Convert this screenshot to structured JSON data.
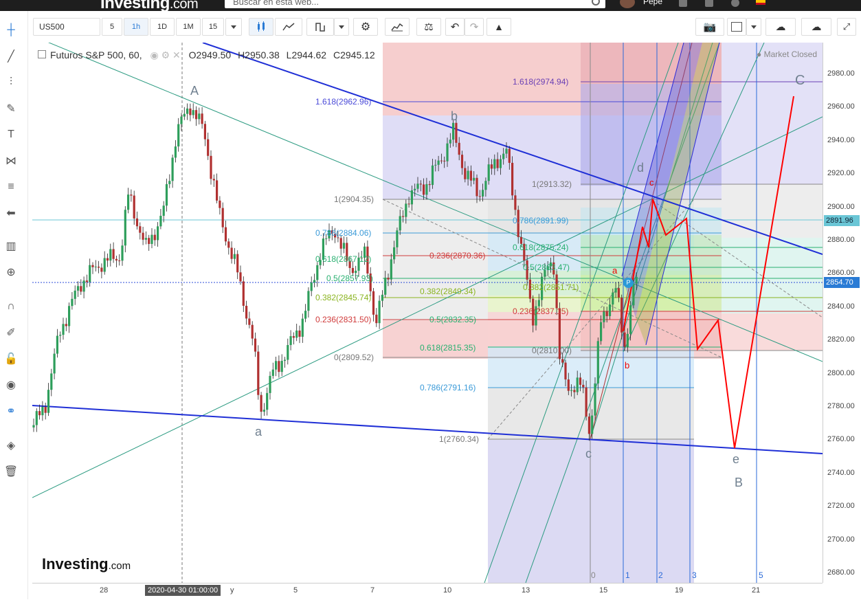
{
  "topbar": {
    "logo_main": "Investing",
    "logo_suffix": ".com",
    "search_placeholder": "Buscar en esta web...",
    "username": "Pepe"
  },
  "toolbar": {
    "symbol": "US500",
    "intervals": [
      "5",
      "1h",
      "1D",
      "1M"
    ],
    "active_interval": "1h",
    "custom_interval": "15"
  },
  "legend": {
    "title": "Futuros S&P 500, 60,",
    "open": "O2949.50",
    "high": "H2950.38",
    "low": "L2944.62",
    "close": "C2945.12"
  },
  "market_status": "Market Closed",
  "watermark_main": "Investing",
  "watermark_suffix": ".com",
  "price_axis": {
    "labels": [
      "2980.00",
      "2960.00",
      "2940.00",
      "2920.00",
      "2900.00",
      "2880.00",
      "2860.00",
      "2840.00",
      "2820.00",
      "2800.00",
      "2780.00",
      "2760.00",
      "2740.00",
      "2720.00",
      "2700.00",
      "2680.00"
    ],
    "tag_horizontal": "2891.96",
    "tag_current": "2854.70"
  },
  "time_axis": {
    "labels": [
      "28",
      "y",
      "5",
      "7",
      "10",
      "13",
      "15",
      "19",
      "21"
    ],
    "crosshair_tag": "2020-04-30 01:00:00"
  },
  "fib_labels": [
    {
      "text": "1.618(2974.94)",
      "color": "#6a40b5"
    },
    {
      "text": "1.618(2962.96)",
      "color": "#4a4ad8"
    },
    {
      "text": "1(2913.32)",
      "color": "#777777"
    },
    {
      "text": "1(2904.35)",
      "color": "#777777"
    },
    {
      "text": "0.786(2891.99)",
      "color": "#3a9ad8"
    },
    {
      "text": "0.786(2884.06)",
      "color": "#3a9ad8"
    },
    {
      "text": "0.618(2875.24)",
      "color": "#28b070"
    },
    {
      "text": "0.236(2870.36)",
      "color": "#d03a3a"
    },
    {
      "text": "0.618(2867.12)",
      "color": "#28b070"
    },
    {
      "text": "0.5(2863.47)",
      "color": "#28b070"
    },
    {
      "text": "0.5(2857.93)",
      "color": "#28b070"
    },
    {
      "text": "0.382(2851.71)",
      "color": "#8ab420"
    },
    {
      "text": "0.382(2849.34)",
      "color": "#8ab420"
    },
    {
      "text": "0.382(2845.74)",
      "color": "#8ab420"
    },
    {
      "text": "0.236(2837.15)",
      "color": "#d03a3a"
    },
    {
      "text": "0.5(2832.35)",
      "color": "#28b070"
    },
    {
      "text": "0.236(2831.50)",
      "color": "#d03a3a"
    },
    {
      "text": "0.618(2815.35)",
      "color": "#28b070"
    },
    {
      "text": "0(2810.00)",
      "color": "#777777"
    },
    {
      "text": "0(2809.52)",
      "color": "#777777"
    },
    {
      "text": "0.786(2791.16)",
      "color": "#3a9ad8"
    },
    {
      "text": "1(2760.34)",
      "color": "#777777"
    }
  ],
  "wave_labels": [
    "A",
    "b",
    "c",
    "d",
    "e",
    "B",
    "C",
    "a"
  ],
  "red_wave_labels": [
    "a",
    "b",
    "c"
  ],
  "gann_numbers": [
    "0",
    "1",
    "2",
    "3",
    "5"
  ],
  "colors": {
    "up_candle": "#2e9e5b",
    "down_candle": "#b03030",
    "trendline": "#1f2fd6",
    "projection": "#ff0000",
    "price_tag": "#2a7bd5"
  }
}
